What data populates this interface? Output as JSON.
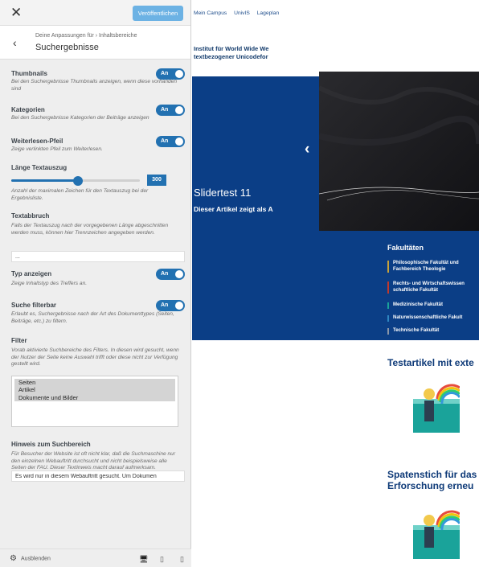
{
  "sidebar": {
    "close_icon": "close-icon",
    "publish_label": "Veröffentlichen",
    "back_icon": "chevron-left-icon",
    "breadcrumb": "Deine Anpassungen für › Inhaltsbereiche",
    "section_title": "Suchergebnisse",
    "thumbnails": {
      "label": "Thumbnails",
      "toggle": "An",
      "desc": "Bei den Suchergebnisse Thumbnails anzeigen, wenn diese vorhanden sind"
    },
    "kategorien": {
      "label": "Kategorien",
      "toggle": "An",
      "desc": "Bei den Suchergebnisse Kategorien der Beiträge anzeigen"
    },
    "weiterlesen": {
      "label": "Weiterlesen-Pfeil",
      "toggle": "An",
      "desc": "Zeige verlinkten Pfeil zum Weiterlesen."
    },
    "laenge": {
      "label": "Länge Textauszug",
      "value": "300",
      "slider_fraction": 0.52,
      "desc": "Anzahl der maximalen Zeichen für den Textauszug bei der Ergebnisliste."
    },
    "textabbruch": {
      "label": "Textabbruch",
      "desc": "Falls der Textauszug nach der vorgegebenen Länge abgeschnitten werden muss, können hier Trennzeichen angegeben werden.",
      "value": "..."
    },
    "typ": {
      "label": "Typ anzeigen",
      "toggle": "An",
      "desc": "Zeige Inhaltstyp des Treffers an."
    },
    "suche_filterbar": {
      "label": "Suche filterbar",
      "toggle": "An",
      "desc": "Erlaubt es, Suchergebnisse nach der Art des Dokumenttypes (Seiten, Beiträge, etc.) zu filtern."
    },
    "filter": {
      "label": "Filter",
      "desc": "Vorab aktivierte Suchbereiche des Filters. In diesen wird gesucht, wenn der Nutzer der Seite keine Auswahl trifft oder diese nicht zur Verfügung gestellt wird.",
      "options": [
        "Seiten",
        "Artikel",
        "Dokumente und Bilder"
      ]
    },
    "hinweis": {
      "label": "Hinweis zum Suchbereich",
      "desc": "Für Besucher der Website ist oft nicht klar, daß die Suchmaschine nur den einzelnen Webauftritt durchsucht und nicht beispielsweise alle Seiten der FAU. Dieser Textinweis macht darauf aufmerksam.",
      "value": "Es wird nur in diesem Webauftritt gesucht. Um Dokumen"
    },
    "footer": {
      "hide_label": "Ausblenden",
      "gear_icon": "gear-icon",
      "device_icons": [
        "desktop-icon",
        "tablet-icon",
        "mobile-icon"
      ]
    },
    "accent_color": "#2271b1"
  },
  "preview": {
    "nav": [
      "Mein Campus",
      "UnivIS",
      "Lageplan"
    ],
    "institute_title": "Institut für World Wide We textbezogener Unicodefor",
    "slider": {
      "title": "Slidertest 11",
      "subtitle": "Dieser Artikel zeigt als A",
      "prev_icon": "chevron-left-icon"
    },
    "faculties": {
      "title": "Fakultäten",
      "items": [
        {
          "label": "Philosophische Fakultät und Fachbereich Theologie",
          "color": "#c8a23a"
        },
        {
          "label": "Rechts- und Wirtschaftswissen schaftliche Fakultät",
          "color": "#c0392b"
        },
        {
          "label": "Medizinische Fakultät",
          "color": "#1aa39a"
        },
        {
          "label": "Naturwissenschaftliche Fakult",
          "color": "#2e86c1"
        },
        {
          "label": "Technische Fakultät",
          "color": "#8a96a8"
        }
      ]
    },
    "articles": [
      {
        "title": "Testartikel mit exte"
      },
      {
        "title": "Spatenstich für das Erforschung erneu"
      }
    ],
    "hero_color": "#0b3e86"
  }
}
